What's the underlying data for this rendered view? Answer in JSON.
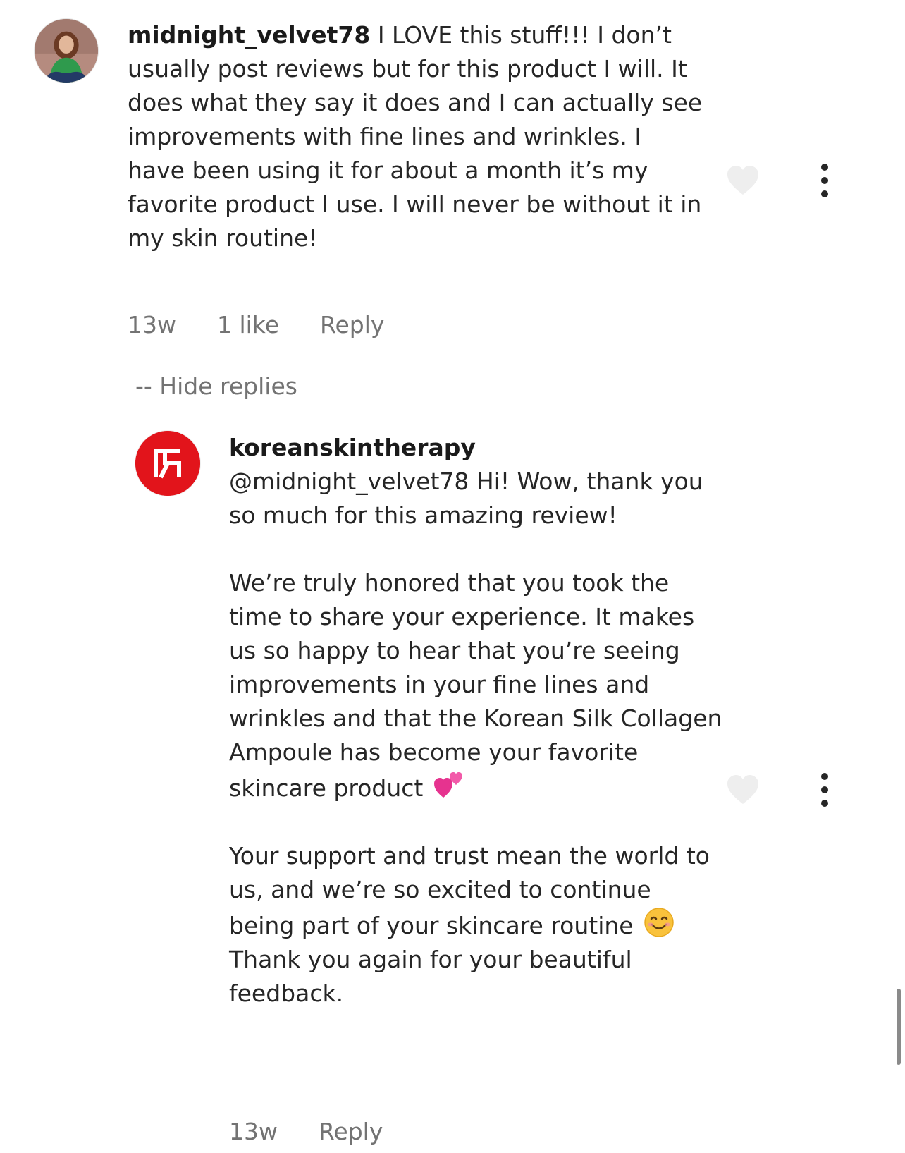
{
  "comment": {
    "username": "midnight_velvet78",
    "text": "I LOVE this stuff!!! I don’t usually post reviews but for this product I will. It does what they say it does and I can actually see improvements with fine lines and wrinkles. I have been using it for about a month it’s my favorite product I use. I will never be without it in my skin routine!",
    "time": "13w",
    "likes": "1 like",
    "reply_label": "Reply",
    "hide_replies_label": "-- Hide replies"
  },
  "reply": {
    "username": "koreanskintherapy",
    "paragraph1": "@midnight_velvet78 Hi! Wow, thank you so much for this amazing review!",
    "paragraph2": "We’re truly honored that you took the time to share your experience. It makes us so happy to hear that you’re seeing improvements in your fine lines and wrinkles and that the Korean Silk Collagen Ampoule has become your favorite skincare product",
    "paragraph3_a": "Your support and trust mean the world to us, and we’re so excited to continue being part of your skincare routine",
    "paragraph3_b": "Thank you again for your beautiful feedback.",
    "time": "13w",
    "reply_label": "Reply"
  },
  "icons": {
    "heart": "heart-icon",
    "more": "more-options-icon",
    "emoji_hearts": "two-hearts-emoji",
    "emoji_smile": "smiling-face-emoji"
  },
  "colors": {
    "brand_red": "#e2141b",
    "muted_text": "#737373",
    "heart_fill": "#eeeeee"
  }
}
